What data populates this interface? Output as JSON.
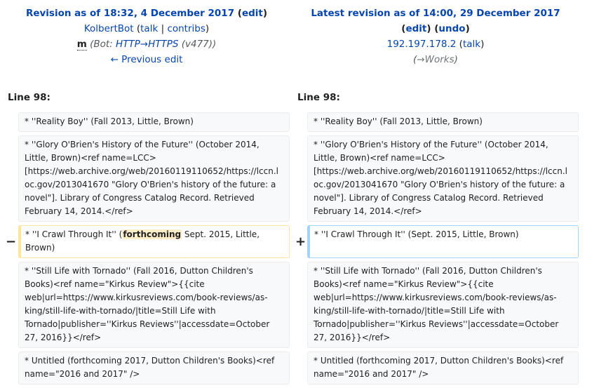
{
  "left_header": {
    "revision_label": "Revision as of 18:32, 4 December 2017",
    "edit_label": "edit",
    "user": "KolbertBot",
    "talk_label": "talk",
    "separator": "|",
    "contribs_label": "contribs",
    "minor_flag": "m",
    "comment_prefix": "(Bot: ",
    "comment_link": "HTTP→HTTPS",
    "comment_suffix": " (v477))",
    "prev_edit_label": "← Previous edit"
  },
  "right_header": {
    "revision_label": "Latest revision as of 14:00, 29 December 2017",
    "edit_label": "edit",
    "undo_label": "undo",
    "user": "192.197.178.2",
    "talk_label": "talk",
    "comment_open": "(",
    "comment_link": "→Works",
    "comment_close": ")"
  },
  "left_line_no": "Line 98:",
  "right_line_no": "Line 98:",
  "del_marker": "−",
  "add_marker": "+",
  "rows": {
    "reality_boy": "* ''Reality Boy'' (Fall 2013, Little, Brown)",
    "glory": "* ''Glory O'Brien's History of the Future'' (October 2014, Little, Brown)<ref name=LCC>[https://web.archive.org/web/20160119110652/https://lccn.loc.gov/2013041670 \"Glory O'Brien's history of the future: a novel\"]. Library of Congress Catalog Record. Retrieved February 14, 2014.</ref>",
    "crawl_left_pre": "* ''I Crawl Through It'' (",
    "crawl_left_hl": "forthcoming",
    "crawl_left_post": " Sept. 2015, Little, Brown)",
    "crawl_right": "* ''I Crawl Through It'' (Sept. 2015, Little, Brown)",
    "still_life": "* ''Still Life with Tornado'' (Fall 2016, Dutton Children's Books)<ref name=\"Kirkus Review\">{{cite web|url=https://www.kirkusreviews.com/book-reviews/as-king/still-life-with-tornado/|title=Still Life with Tornado|publisher=''Kirkus Reviews''|accessdate=October 27, 2016}}</ref>",
    "untitled": "* Untitled (forthcoming 2017, Dutton Children's Books)<ref name=\"2016 and 2017\" />"
  }
}
